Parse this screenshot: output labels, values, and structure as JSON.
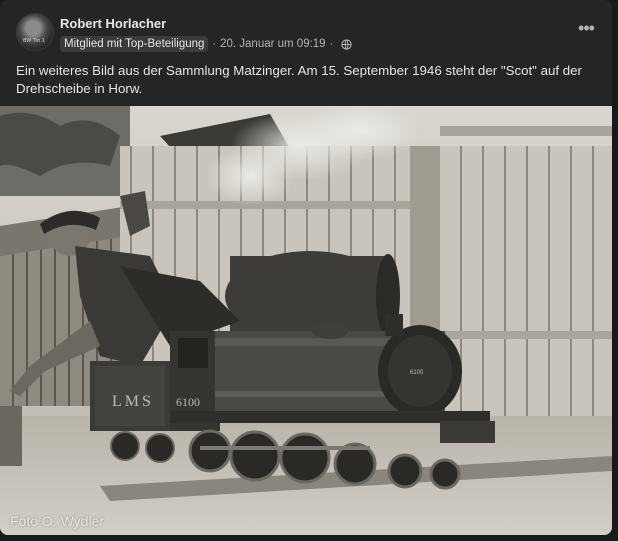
{
  "post": {
    "author": "Robert Horlacher",
    "badge": "Mitglied mit Top-Beteiligung",
    "separator": "·",
    "time": "20. Januar um 09:19",
    "more_icon": "more-horizontal-icon",
    "privacy_icon": "globe-icon",
    "text": "Ein weiteres Bild aus der Sammlung Matzinger. Am 15. September 1946 steht der \"Scot\" auf der Drehscheibe in Horw.",
    "avatar_caption": "BW Tin 1",
    "photo": {
      "watermark": "Foto O. Wydler",
      "tender_lettering": "LMS",
      "cab_number": "6100",
      "smokebox_number": "6100"
    }
  }
}
